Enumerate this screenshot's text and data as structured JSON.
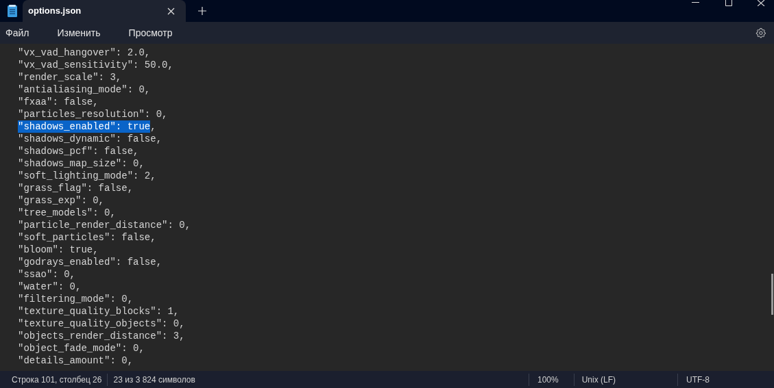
{
  "window": {
    "tab_title": "options.json"
  },
  "menu": [
    "Файл",
    "Изменить",
    "Просмотр"
  ],
  "lines": [
    {
      "text": "\"vx_vad_hangover\": 2.0,",
      "selected": false
    },
    {
      "text": "\"vx_vad_sensitivity\": 50.0,",
      "selected": false
    },
    {
      "text": "\"render_scale\": 3,",
      "selected": false
    },
    {
      "text": "\"antialiasing_mode\": 0,",
      "selected": false
    },
    {
      "text": "\"fxaa\": false,",
      "selected": false
    },
    {
      "text": "\"particles_resolution\": 0,",
      "selected": false
    },
    {
      "parts": [
        {
          "text": "\"shadows_enabled\": true",
          "selected": true
        },
        {
          "text": ",",
          "selected": false
        }
      ]
    },
    {
      "text": "\"shadows_dynamic\": false,",
      "selected": false
    },
    {
      "text": "\"shadows_pcf\": false,",
      "selected": false
    },
    {
      "text": "\"shadows_map_size\": 0,",
      "selected": false
    },
    {
      "text": "\"soft_lighting_mode\": 2,",
      "selected": false
    },
    {
      "text": "\"grass_flag\": false,",
      "selected": false
    },
    {
      "text": "\"grass_exp\": 0,",
      "selected": false
    },
    {
      "text": "\"tree_models\": 0,",
      "selected": false
    },
    {
      "text": "\"particle_render_distance\": 0,",
      "selected": false
    },
    {
      "text": "\"soft_particles\": false,",
      "selected": false
    },
    {
      "text": "\"bloom\": true,",
      "selected": false
    },
    {
      "text": "\"godrays_enabled\": false,",
      "selected": false
    },
    {
      "text": "\"ssao\": 0,",
      "selected": false
    },
    {
      "text": "\"water\": 0,",
      "selected": false
    },
    {
      "text": "\"filtering_mode\": 0,",
      "selected": false
    },
    {
      "text": "\"texture_quality_blocks\": 1,",
      "selected": false
    },
    {
      "text": "\"texture_quality_objects\": 0,",
      "selected": false
    },
    {
      "text": "\"objects_render_distance\": 3,",
      "selected": false
    },
    {
      "text": "\"object_fade_mode\": 0,",
      "selected": false
    },
    {
      "text": "\"details_amount\": 0,",
      "selected": false
    }
  ],
  "status_bar": {
    "position": "Строка 101, столбец 26",
    "selection": "23 из 3 824 символов",
    "zoom": "100%",
    "line_endings": "Unix (LF)",
    "encoding": "UTF-8"
  }
}
